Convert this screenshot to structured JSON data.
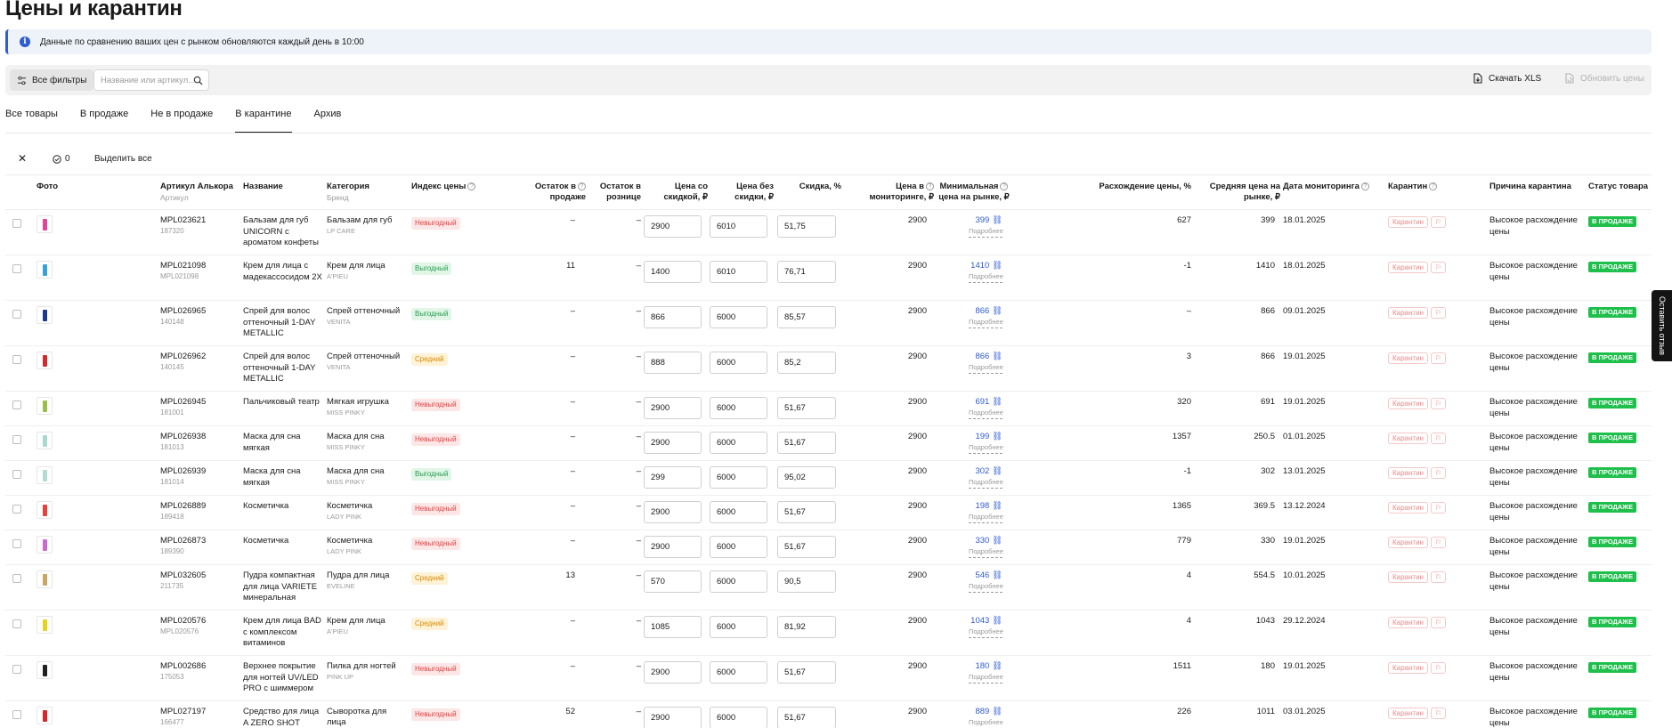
{
  "page": {
    "title": "Цены и карантин",
    "banner": "Данные по сравнению ваших цен с рынком обновляются каждый день в 10:00"
  },
  "toolbar": {
    "filters_label": "Все фильтры",
    "search_placeholder": "Название или артикул...",
    "download_label": "Скачать XLS",
    "refresh_label": "Обновить цены"
  },
  "tabs": [
    "Все товары",
    "В продаже",
    "Не в продаже",
    "В карантине",
    "Архив"
  ],
  "active_tab": "В карантине",
  "selection": {
    "count": "0",
    "select_all_label": "Выделить все"
  },
  "table": {
    "headers": {
      "photo": "Фото",
      "article": "Артикул Алькора",
      "article_sub": "Артикул",
      "name": "Название",
      "category": "Категория",
      "category_sub": "Бренд",
      "price_index": "Индекс цены",
      "stock_line1": "Остаток в",
      "stock_line2": "продаже",
      "retail_line1": "Остаток в",
      "retail_line2": "рознице",
      "disc_price_line1": "Цена со",
      "disc_price_line2": "скидкой, ₽",
      "base_price_line1": "Цена без",
      "base_price_line2": "скидки, ₽",
      "discount": "Скидка, %",
      "monitor_line1": "Цена в",
      "monitor_line2": "мониторинге, ₽",
      "min_line1": "Минимальная",
      "min_line2": "цена на рынке, ₽",
      "diff": "Расхождение цены, %",
      "avg_line1": "Средняя цена на",
      "avg_line2": "рынке, ₽",
      "date": "Дата мониторинга",
      "quarantine": "Карантин",
      "reason": "Причина карантина",
      "status": "Статус товара"
    },
    "quarantine_label": "Карантин",
    "more_label": "Подробнее",
    "rows": [
      {
        "article": "MPL023621",
        "article_sub": "187320",
        "name": "Бальзам для губ UNICORN с ароматом конфеты",
        "category": "Бальзам для губ",
        "brand": "LP CARE",
        "index": "Невыгодный",
        "index_type": "bad",
        "stock": "–",
        "retail": "–",
        "price_disc": "2900",
        "price_base": "6010",
        "discount": "51,75",
        "monitor": "2900",
        "min_price": "399",
        "diff": "627",
        "avg": "399",
        "date": "18.01.2025",
        "reason": "Высокое расхождение цены",
        "status": "В ПРОДАЖЕ",
        "thumb_color": "#e0459a"
      },
      {
        "article": "MPL021098",
        "article_sub": "MPL021098",
        "name": "Крем для лица с мадекассосидом 2X",
        "category": "Крем для лица",
        "brand": "A'PIEU",
        "index": "Выгодный",
        "index_type": "good",
        "stock": "11",
        "retail": "–",
        "price_disc": "1400",
        "price_base": "6010",
        "discount": "76,71",
        "monitor": "2900",
        "min_price": "1410",
        "diff": "-1",
        "avg": "1410",
        "date": "18.01.2025",
        "reason": "Высокое расхождение цены",
        "status": "В ПРОДАЖЕ",
        "thumb_color": "#3aa0d8"
      },
      {
        "article": "MPL026965",
        "article_sub": "140148",
        "name": "Спрей для волос оттеночный 1-DAY METALLIC",
        "category": "Спрей оттеночный",
        "brand": "VENITA",
        "index": "Выгодный",
        "index_type": "good",
        "stock": "–",
        "retail": "–",
        "price_disc": "866",
        "price_base": "6000",
        "discount": "85,57",
        "monitor": "2900",
        "min_price": "866",
        "diff": "–",
        "avg": "866",
        "date": "09.01.2025",
        "reason": "Высокое расхождение цены",
        "status": "В ПРОДАЖЕ",
        "thumb_color": "#1c3a8a"
      },
      {
        "article": "MPL026962",
        "article_sub": "140145",
        "name": "Спрей для волос оттеночный 1-DAY METALLIC",
        "category": "Спрей оттеночный",
        "brand": "VENITA",
        "index": "Средний",
        "index_type": "mid",
        "stock": "–",
        "retail": "–",
        "price_disc": "888",
        "price_base": "6000",
        "discount": "85,2",
        "monitor": "2900",
        "min_price": "866",
        "diff": "3",
        "avg": "866",
        "date": "19.01.2025",
        "reason": "Высокое расхождение цены",
        "status": "В ПРОДАЖЕ",
        "thumb_color": "#d42a2a"
      },
      {
        "article": "MPL026945",
        "article_sub": "181001",
        "name": "Пальчиковый театр",
        "category": "Мягкая игрушка",
        "brand": "MISS PINKY",
        "index": "Невыгодный",
        "index_type": "bad",
        "stock": "–",
        "retail": "–",
        "price_disc": "2900",
        "price_base": "6000",
        "discount": "51,67",
        "monitor": "2900",
        "min_price": "691",
        "diff": "320",
        "avg": "691",
        "date": "19.01.2025",
        "reason": "Высокое расхождение цены",
        "status": "В ПРОДАЖЕ",
        "thumb_color": "#9bbd4a"
      },
      {
        "article": "MPL026938",
        "article_sub": "181013",
        "name": "Маска для сна мягкая",
        "category": "Маска для сна",
        "brand": "MISS PINKY",
        "index": "Невыгодный",
        "index_type": "bad",
        "stock": "–",
        "retail": "–",
        "price_disc": "2900",
        "price_base": "6000",
        "discount": "51,67",
        "monitor": "2900",
        "min_price": "199",
        "diff": "1357",
        "avg": "250.5",
        "date": "01.01.2025",
        "reason": "Высокое расхождение цены",
        "status": "В ПРОДАЖЕ",
        "thumb_color": "#a8d8d0"
      },
      {
        "article": "MPL026939",
        "article_sub": "181014",
        "name": "Маска для сна мягкая",
        "category": "Маска для сна",
        "brand": "MISS PINKY",
        "index": "Выгодный",
        "index_type": "good",
        "stock": "–",
        "retail": "–",
        "price_disc": "299",
        "price_base": "6000",
        "discount": "95,02",
        "monitor": "2900",
        "min_price": "302",
        "diff": "-1",
        "avg": "302",
        "date": "13.01.2025",
        "reason": "Высокое расхождение цены",
        "status": "В ПРОДАЖЕ",
        "thumb_color": "#b0dcd4"
      },
      {
        "article": "MPL026889",
        "article_sub": "189418",
        "name": "Косметичка",
        "category": "Косметичка",
        "brand": "LADY PINK",
        "index": "Невыгодный",
        "index_type": "bad",
        "stock": "–",
        "retail": "–",
        "price_disc": "2900",
        "price_base": "6000",
        "discount": "51,67",
        "monitor": "2900",
        "min_price": "198",
        "diff": "1365",
        "avg": "369.5",
        "date": "13.12.2024",
        "reason": "Высокое расхождение цены",
        "status": "В ПРОДАЖЕ",
        "thumb_color": "#e8403a"
      },
      {
        "article": "MPL026873",
        "article_sub": "189390",
        "name": "Косметичка",
        "category": "Косметичка",
        "brand": "LADY PINK",
        "index": "Невыгодный",
        "index_type": "bad",
        "stock": "–",
        "retail": "–",
        "price_disc": "2900",
        "price_base": "6000",
        "discount": "51,67",
        "monitor": "2900",
        "min_price": "330",
        "diff": "779",
        "avg": "330",
        "date": "19.01.2025",
        "reason": "Высокое расхождение цены",
        "status": "В ПРОДАЖЕ",
        "thumb_color": "#c86ad0"
      },
      {
        "article": "MPL032605",
        "article_sub": "211735",
        "name": "Пудра компактная для лица VARIETE минеральная",
        "category": "Пудра для лица",
        "brand": "EVELINE",
        "index": "Средний",
        "index_type": "mid",
        "stock": "13",
        "retail": "–",
        "price_disc": "570",
        "price_base": "6000",
        "discount": "90,5",
        "monitor": "2900",
        "min_price": "546",
        "diff": "4",
        "avg": "554.5",
        "date": "10.01.2025",
        "reason": "Высокое расхождение цены",
        "status": "В ПРОДАЖЕ",
        "thumb_color": "#c9a566"
      },
      {
        "article": "MPL020576",
        "article_sub": "MPL020576",
        "name": "Крем для лица BAD с комплексом витаминов",
        "category": "Крем для лица",
        "brand": "A'PIEU",
        "index": "Средний",
        "index_type": "mid",
        "stock": "–",
        "retail": "–",
        "price_disc": "1085",
        "price_base": "6000",
        "discount": "81,92",
        "monitor": "2900",
        "min_price": "1043",
        "diff": "4",
        "avg": "1043",
        "date": "29.12.2024",
        "reason": "Высокое расхождение цены",
        "status": "В ПРОДАЖЕ",
        "thumb_color": "#e8d21a"
      },
      {
        "article": "MPL002686",
        "article_sub": "175053",
        "name": "Верхнее покрытие для ногтей UV/LED PRO с шиммером",
        "category": "Пилка для ногтей",
        "brand": "PINK UP",
        "index": "Невыгодный",
        "index_type": "bad",
        "stock": "–",
        "retail": "–",
        "price_disc": "2900",
        "price_base": "6000",
        "discount": "51,67",
        "monitor": "2900",
        "min_price": "180",
        "diff": "1511",
        "avg": "180",
        "date": "19.01.2025",
        "reason": "Высокое расхождение цены",
        "status": "В ПРОДАЖЕ",
        "thumb_color": "#222222"
      },
      {
        "article": "MPL027197",
        "article_sub": "166477",
        "name": "Средство для лица A ZERO SHOT",
        "category": "Сыворотка для лица",
        "brand": "",
        "index": "Невыгодный",
        "index_type": "bad",
        "stock": "52",
        "retail": "–",
        "price_disc": "2900",
        "price_base": "6000",
        "discount": "51,67",
        "monitor": "2900",
        "min_price": "889",
        "diff": "226",
        "avg": "1011",
        "date": "03.01.2025",
        "reason": "Высокое расхождение цены",
        "status": "В ПРОДАЖЕ",
        "thumb_color": "#d8262a"
      }
    ]
  },
  "feedback_label": "Оставить отзыв",
  "colors": {
    "accent": "#2f5bd3",
    "status_green": "#1fbf4b",
    "bad": "#e0403f",
    "good": "#219d4e",
    "mid": "#d58a00"
  }
}
